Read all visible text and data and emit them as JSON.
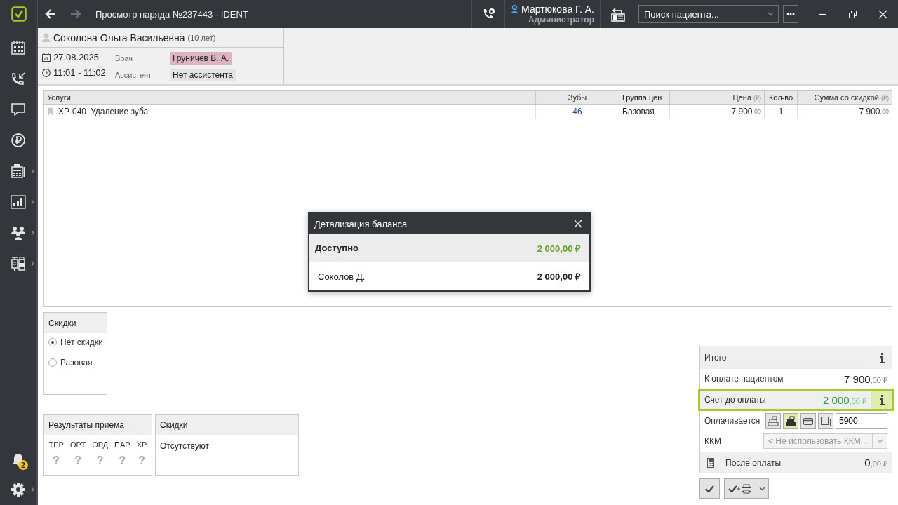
{
  "window": {
    "title": "Просмотр наряда №237443 - IDENT"
  },
  "navigation": [
    {
      "kind": "back",
      "disabled": false
    },
    {
      "kind": "forward",
      "disabled": true
    }
  ],
  "user": {
    "name": "Мартюкова Г. А.",
    "role": "Администратор"
  },
  "search": {
    "placeholder": "Поиск пациента..."
  },
  "sidebar": {
    "items": [
      {
        "kind": "schedule",
        "has_submenu": false
      },
      {
        "kind": "calls",
        "has_submenu": false
      },
      {
        "kind": "chat",
        "has_submenu": false
      },
      {
        "kind": "payments",
        "has_submenu": false
      },
      {
        "kind": "register",
        "has_submenu": true
      },
      {
        "kind": "reports",
        "has_submenu": true
      },
      {
        "kind": "people",
        "has_submenu": true
      },
      {
        "kind": "stock",
        "has_submenu": true
      }
    ],
    "bottom": [
      {
        "kind": "bell",
        "badge": "2",
        "has_submenu": false
      },
      {
        "kind": "gear",
        "has_submenu": true
      }
    ]
  },
  "patient": {
    "name": "Соколова Ольга Васильевна",
    "age": "(10 лет)",
    "date": "27.08.2025",
    "time": "11:01 - 11:02",
    "staff": [
      {
        "label": "Врач",
        "value": "Груничев В. А.",
        "color": "#dcb4bf"
      },
      {
        "label": "Ассистент",
        "value": "Нет ассистента",
        "color": "#e3e3e3"
      }
    ]
  },
  "table": {
    "columns": [
      {
        "label": "Услуги"
      },
      {
        "label": "Зубы"
      },
      {
        "label": "Группа цен"
      },
      {
        "label": "Цена",
        "unit": "(₽)"
      },
      {
        "label": "Кол-во"
      },
      {
        "label": "Сумма со скидкой",
        "unit": "(₽)"
      }
    ],
    "rows": [
      {
        "code": "ХР-040",
        "name": "Удаление зуба",
        "teeth": "46",
        "price_group": "Базовая",
        "price": "7 900",
        "price_cents": ",00",
        "qty": "1",
        "sum": "7 900",
        "sum_cents": ",00"
      }
    ]
  },
  "discounts": {
    "title": "Скидки",
    "options": [
      {
        "label": "Нет скидки",
        "selected": true
      },
      {
        "label": "Разовая",
        "selected": false
      }
    ]
  },
  "results": {
    "title": "Результаты приема",
    "columns": [
      {
        "label": "ТЕР",
        "value": "?"
      },
      {
        "label": "ОРТ",
        "value": "?"
      },
      {
        "label": "ОРД",
        "value": "?"
      },
      {
        "label": "ПАР",
        "value": "?"
      },
      {
        "label": "ХР",
        "value": "?"
      }
    ]
  },
  "discount_info": {
    "title": "Скидки",
    "text": "Отсутствуют"
  },
  "totals": {
    "title": "Итого",
    "to_pay": {
      "label": "К оплате пациентом",
      "amount": "7 900",
      "cents": ",00 ₽"
    },
    "account": {
      "label": "Счет до оплаты",
      "amount": "2 000",
      "cents": ",00 ₽",
      "highlighted": true
    },
    "paying": {
      "label": "Оплачивается",
      "value": "5900",
      "methods": [
        {
          "kind": "cash",
          "selected": false
        },
        {
          "kind": "register",
          "selected": true
        },
        {
          "kind": "card",
          "selected": false
        },
        {
          "kind": "transfer",
          "selected": false
        }
      ]
    },
    "kkm": {
      "label": "ККМ",
      "value": "< Не использовать ККМ...",
      "disabled": true
    },
    "after": {
      "label": "После оплаты",
      "amount": "0",
      "cents": ",00 ₽"
    }
  },
  "dialog": {
    "title": "Детализация баланса",
    "rows": [
      {
        "kind": "total",
        "label": "Доступно",
        "amount": "2 000,00 ₽"
      },
      {
        "kind": "person",
        "label": "Соколов Д.",
        "amount": "2 000,00 ₽"
      }
    ]
  }
}
